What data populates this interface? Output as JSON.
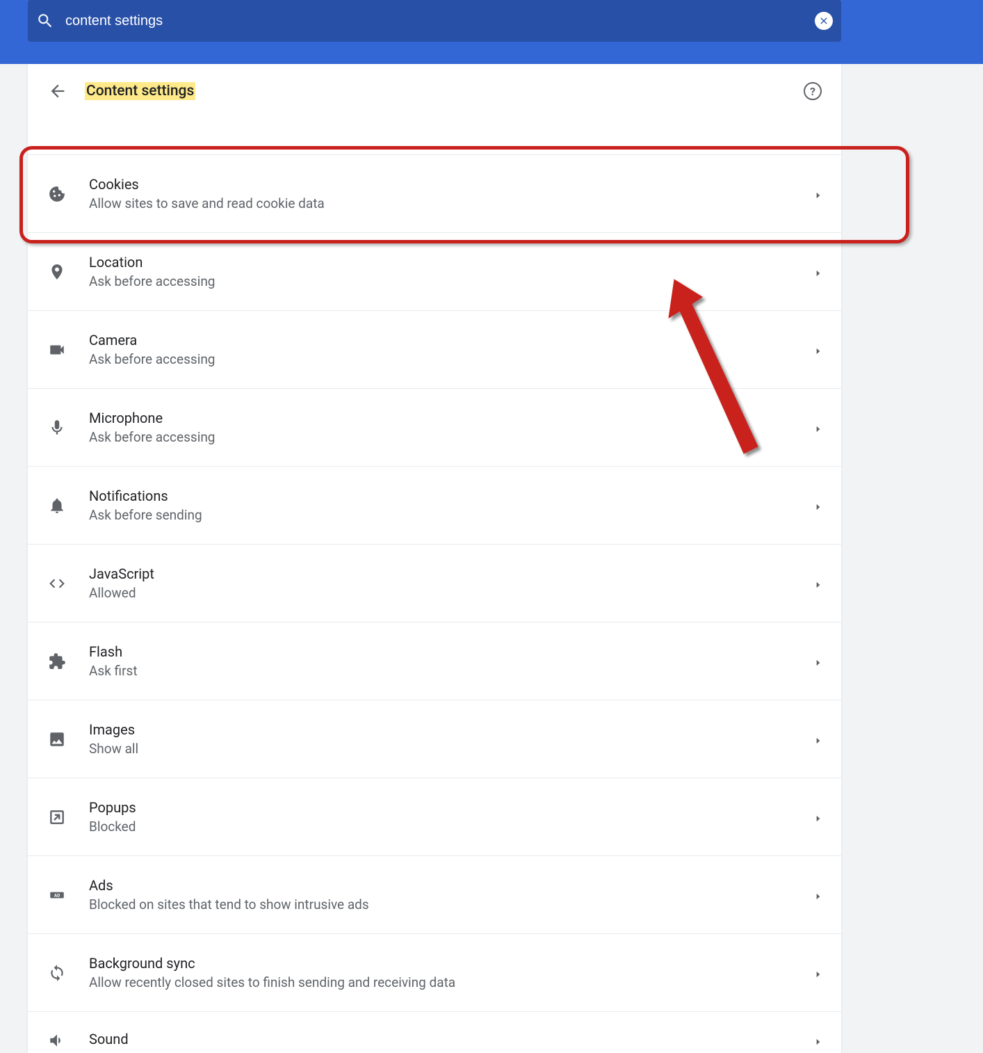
{
  "search": {
    "value": "content settings"
  },
  "header": {
    "title": "Content settings"
  },
  "rows": [
    {
      "id": "cookies",
      "title": "Cookies",
      "sub": "Allow sites to save and read cookie data"
    },
    {
      "id": "location",
      "title": "Location",
      "sub": "Ask before accessing"
    },
    {
      "id": "camera",
      "title": "Camera",
      "sub": "Ask before accessing"
    },
    {
      "id": "microphone",
      "title": "Microphone",
      "sub": "Ask before accessing"
    },
    {
      "id": "notifications",
      "title": "Notifications",
      "sub": "Ask before sending"
    },
    {
      "id": "javascript",
      "title": "JavaScript",
      "sub": "Allowed"
    },
    {
      "id": "flash",
      "title": "Flash",
      "sub": "Ask first"
    },
    {
      "id": "images",
      "title": "Images",
      "sub": "Show all"
    },
    {
      "id": "popups",
      "title": "Popups",
      "sub": "Blocked"
    },
    {
      "id": "ads",
      "title": "Ads",
      "sub": "Blocked on sites that tend to show intrusive ads"
    },
    {
      "id": "background-sync",
      "title": "Background sync",
      "sub": "Allow recently closed sites to finish sending and receiving data"
    },
    {
      "id": "sound",
      "title": "Sound",
      "sub": ""
    }
  ],
  "annotation": {
    "highlight_row": "cookies"
  }
}
